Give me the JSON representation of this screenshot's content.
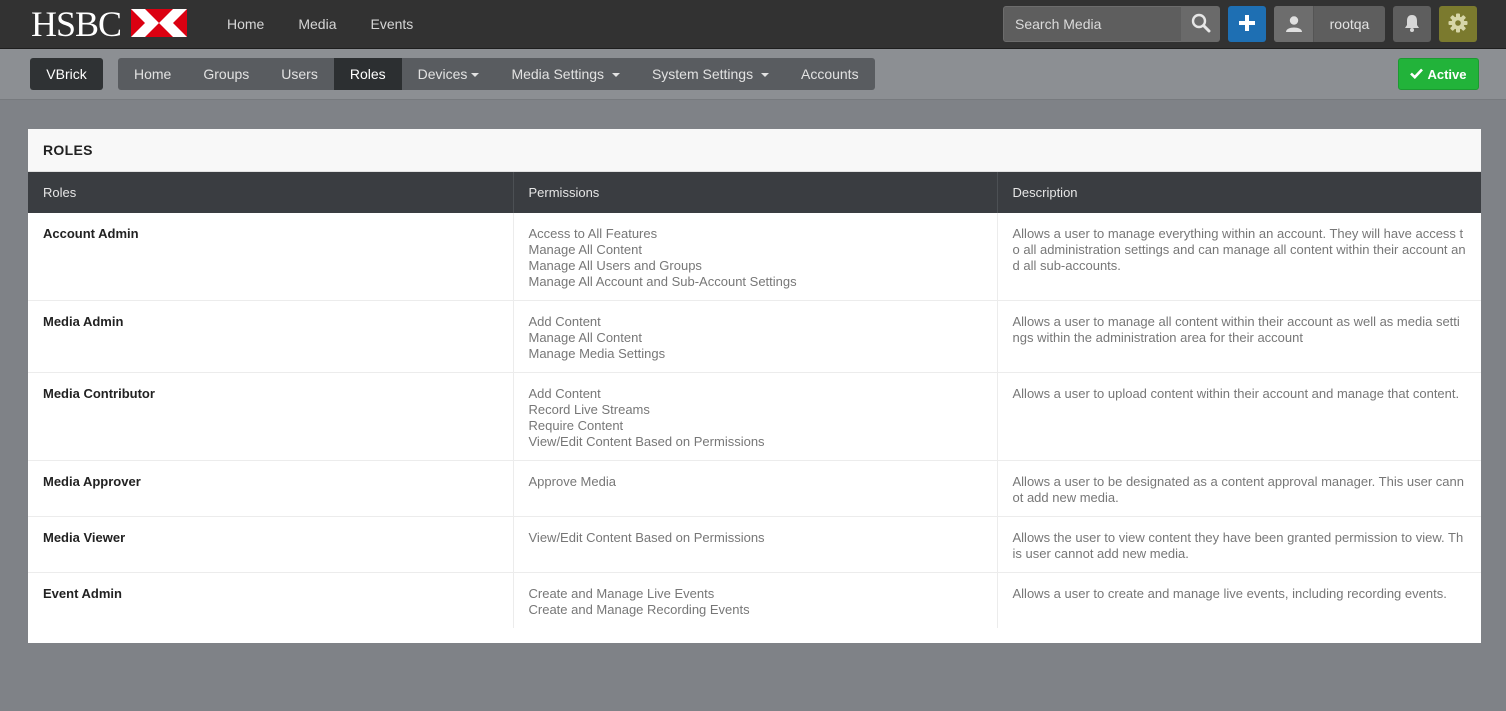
{
  "brand": {
    "logo_text": "HSBC"
  },
  "top_nav": [
    "Home",
    "Media",
    "Events"
  ],
  "search": {
    "placeholder": "Search Media"
  },
  "user": {
    "name": "rootqa"
  },
  "account_name": "VBrick",
  "admin_nav": [
    {
      "label": "Home",
      "active": false,
      "dropdown": false
    },
    {
      "label": "Groups",
      "active": false,
      "dropdown": false
    },
    {
      "label": "Users",
      "active": false,
      "dropdown": false
    },
    {
      "label": "Roles",
      "active": true,
      "dropdown": false
    },
    {
      "label": "Devices",
      "active": false,
      "dropdown": true
    },
    {
      "label": "Media Settings",
      "active": false,
      "dropdown": true
    },
    {
      "label": "System Settings",
      "active": false,
      "dropdown": true
    },
    {
      "label": "Accounts",
      "active": false,
      "dropdown": false
    }
  ],
  "status_button": {
    "label": "Active"
  },
  "panel": {
    "title": "ROLES"
  },
  "table": {
    "headers": [
      "Roles",
      "Permissions",
      "Description"
    ],
    "rows": [
      {
        "role": "Account Admin",
        "permissions": [
          "Access to All Features",
          "Manage All Content",
          "Manage All Users and Groups",
          "Manage All Account and Sub-Account Settings"
        ],
        "description": "Allows a user to manage everything within an account. They will have access to all administration settings and can manage all content within their account and all sub-accounts."
      },
      {
        "role": "Media Admin",
        "permissions": [
          "Add Content",
          "Manage All Content",
          "Manage Media Settings"
        ],
        "description": "Allows a user to manage all content within their account as well as media settings within the administration area for their account"
      },
      {
        "role": "Media Contributor",
        "permissions": [
          "Add Content",
          "Record Live Streams",
          "Require Content",
          "View/Edit Content Based on Permissions"
        ],
        "description": "Allows a user to upload content within their account and manage that content."
      },
      {
        "role": "Media Approver",
        "permissions": [
          "Approve Media"
        ],
        "description": "Allows a user to be designated as a content approval manager. This user cannot add new media."
      },
      {
        "role": "Media Viewer",
        "permissions": [
          "View/Edit Content Based on Permissions"
        ],
        "description": "Allows the user to view content they have been granted permission to view. This user cannot add new media."
      },
      {
        "role": "Event Admin",
        "permissions": [
          "Create and Manage Live Events",
          "Create and Manage Recording Events"
        ],
        "description": "Allows a user to create and manage live events, including recording events."
      }
    ]
  },
  "colors": {
    "topbar": "#323232",
    "add_button": "#1e6fb3",
    "active_button": "#22b33a",
    "gear_button": "#7b7a2e",
    "table_header": "#3a3d41",
    "hsbc_red": "#db0011"
  },
  "icons": [
    "hsbc-hexagon-icon",
    "search-icon",
    "plus-icon",
    "user-icon",
    "bell-icon",
    "gear-icon",
    "check-icon",
    "caret-down-icon"
  ]
}
